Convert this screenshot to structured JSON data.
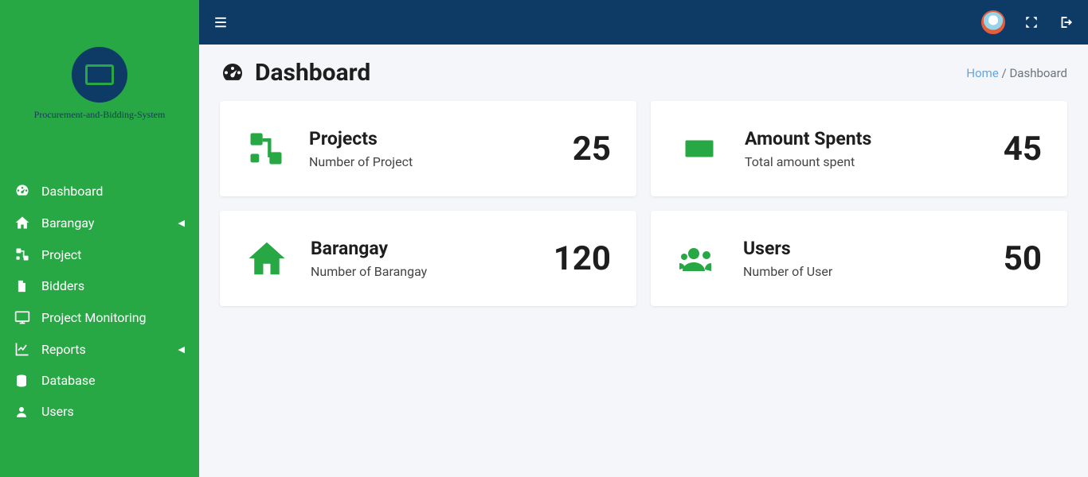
{
  "brand": {
    "name": "Procurement-and-Bidding-System"
  },
  "sidebar": {
    "items": [
      {
        "label": "Dashboard",
        "icon": "tachometer",
        "chev": false
      },
      {
        "label": "Barangay",
        "icon": "home",
        "chev": true
      },
      {
        "label": "Project",
        "icon": "project",
        "chev": false
      },
      {
        "label": "Bidders",
        "icon": "file",
        "chev": false
      },
      {
        "label": "Project Monitoring",
        "icon": "monitor",
        "chev": false
      },
      {
        "label": "Reports",
        "icon": "chart",
        "chev": true
      },
      {
        "label": "Database",
        "icon": "database",
        "chev": false
      },
      {
        "label": "Users",
        "icon": "user",
        "chev": false
      }
    ]
  },
  "page": {
    "title": "Dashboard",
    "breadcrumb_home": "Home",
    "breadcrumb_sep": "/",
    "breadcrumb_current": "Dashboard"
  },
  "cards": [
    {
      "title": "Projects",
      "sub": "Number of Project",
      "value": "25",
      "icon": "project"
    },
    {
      "title": "Amount Spents",
      "sub": "Total amount spent",
      "value": "45",
      "icon": "money"
    },
    {
      "title": "Barangay",
      "sub": "Number of Barangay",
      "value": "120",
      "icon": "home"
    },
    {
      "title": "Users",
      "sub": "Number of User",
      "value": "50",
      "icon": "users"
    }
  ]
}
